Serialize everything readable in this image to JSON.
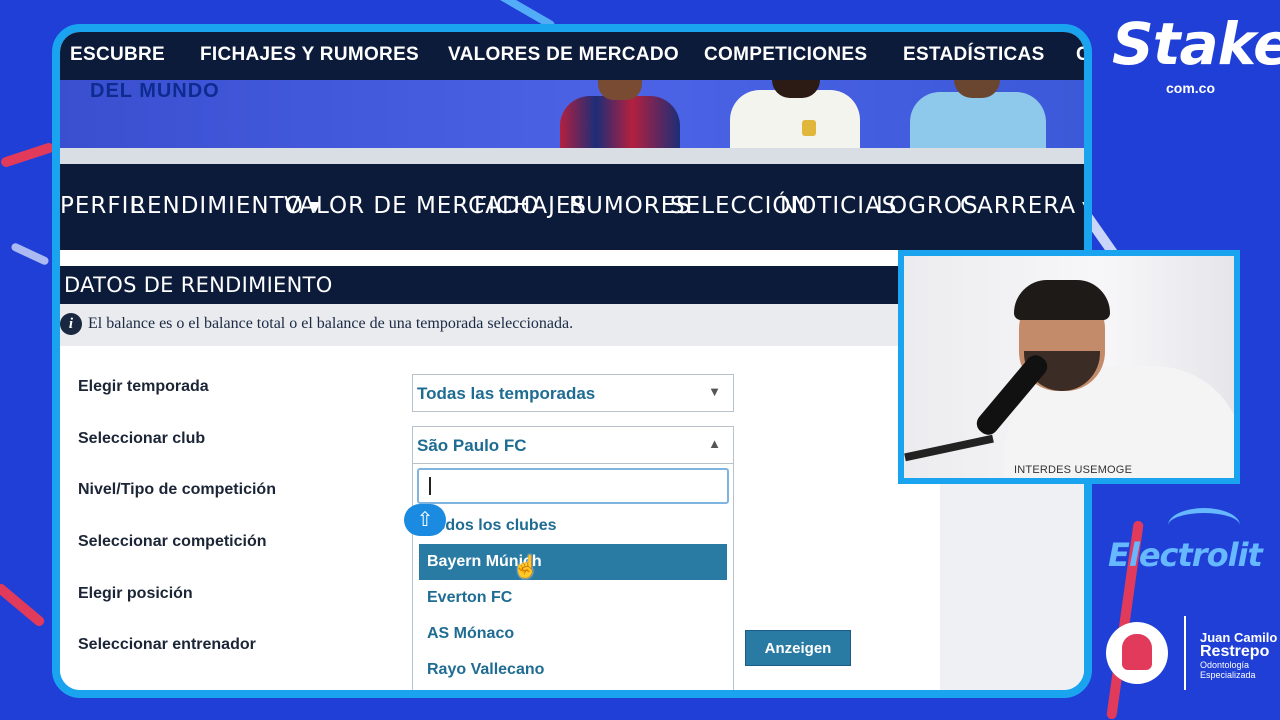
{
  "top_nav": {
    "items": [
      "ESCUBRE",
      "FICHAJES Y RUMORES",
      "VALORES DE MERCADO",
      "COMPETICIONES",
      "ESTADÍSTICAS",
      "C"
    ]
  },
  "banner": {
    "text": "DEL MUNDO"
  },
  "profile_nav": {
    "items": [
      "PERFIL",
      "RENDIMIENTO",
      "VALOR DE MERCADO",
      "FICHAJES",
      "RUMORES",
      "SELECCIÓN",
      "NOTICIAS",
      "LOGROS",
      "CARRERA"
    ],
    "caret": "▼"
  },
  "section": {
    "title": "DATOS DE RENDIMIENTO",
    "info_icon": "i",
    "info_text": "El balance es o el balance total o el balance de una temporada seleccionada."
  },
  "form": {
    "labels": [
      "Elegir temporada",
      "Seleccionar club",
      "Nivel/Tipo de competición",
      "Seleccionar competición",
      "Elegir posición",
      "Seleccionar entrenador"
    ],
    "season_select": {
      "value": "Todas las temporadas",
      "arrow": "▼"
    },
    "club_select": {
      "value": "São Paulo FC",
      "arrow": "▲"
    },
    "dropdown": {
      "search_value": "",
      "options": [
        "Todos los clubes",
        "Bayern Múnich",
        "Everton FC",
        "AS Mónaco",
        "Rayo Vallecano"
      ],
      "highlighted": "Bayern Múnich"
    },
    "submit_label": "Anzeigen"
  },
  "overlay": {
    "shift_icon": "⇧",
    "cursor_icon": "☝"
  },
  "webcam": {
    "shirt_text": "INTERDES USEMOGE"
  },
  "sponsors": {
    "stake": "Stake",
    "stake_domain": "com.co",
    "electrolit": "Electrolit",
    "dental_name_1": "Juan Camilo",
    "dental_name_2": "Restrepo",
    "dental_sub_1": "Odontología",
    "dental_sub_2": "Especializada"
  },
  "colors": {
    "nav_bg": "#0c1b3a",
    "accent": "#2a7ba3",
    "frame": "#1aa4f0",
    "stream_bg": "#1f3fd6"
  }
}
